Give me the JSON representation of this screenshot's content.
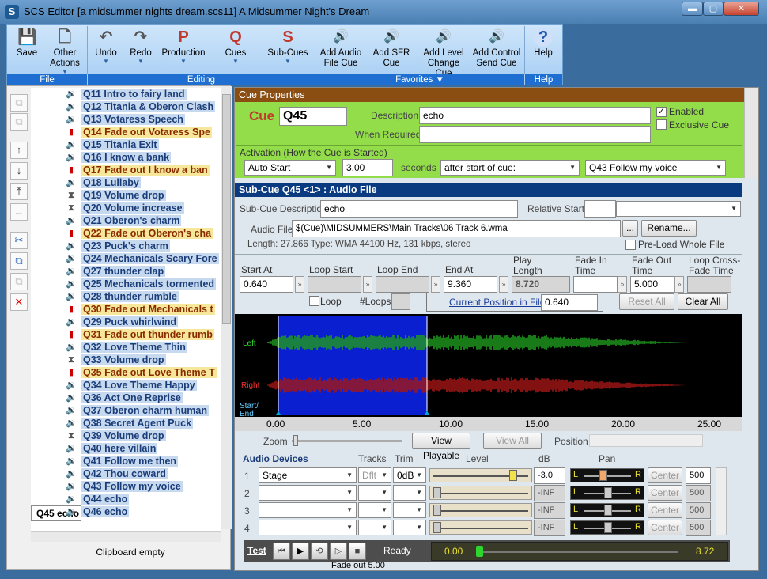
{
  "window": {
    "app_icon": "S",
    "title": "SCS Editor  [a midsummer nights dream.scs11]  A Midsummer Night's Dream",
    "min": "▬",
    "max": "▢",
    "close": "✕"
  },
  "ribbon": {
    "buttons": [
      {
        "label": "Save",
        "icon": "💾",
        "color": "#1a56b0"
      },
      {
        "label": "Other Actions",
        "icon": "🗋",
        "color": "#555555"
      },
      {
        "label": "Undo",
        "icon": "↶",
        "color": "#555555"
      },
      {
        "label": "Redo",
        "icon": "↷",
        "color": "#555555"
      },
      {
        "label": "Production",
        "icon": "P",
        "color": "#c0392b"
      },
      {
        "label": "Cues",
        "icon": "Q",
        "color": "#c0392b"
      },
      {
        "label": "Sub-Cues",
        "icon": "S",
        "color": "#c0392b"
      },
      {
        "label": "Add Audio File Cue",
        "icon": "🔊",
        "color": "#1a56b0"
      },
      {
        "label": "Add SFR Cue",
        "icon": "🔊",
        "color": "#1a56b0"
      },
      {
        "label": "Add Level Change Cue",
        "icon": "🔊",
        "color": "#1a56b0"
      },
      {
        "label": "Add Control Send Cue",
        "icon": "🔊",
        "color": "#1a56b0"
      },
      {
        "label": "Help",
        "icon": "?",
        "color": "#1a56b0"
      }
    ],
    "groups": {
      "file": "File",
      "editing": "Editing",
      "favorites": "Favorites ▼",
      "help": "Help"
    }
  },
  "cue_list": [
    {
      "label": "Q11 Intro to fairy land",
      "type": "audio"
    },
    {
      "label": "Q12 Titania & Oberon Clash",
      "type": "audio"
    },
    {
      "label": "Q13 Votaress Speech",
      "type": "audio"
    },
    {
      "label": "Q14 Fade out Votaress Spe",
      "type": "fade"
    },
    {
      "label": "Q15 Titania Exit",
      "type": "audio"
    },
    {
      "label": "Q16 I know a bank",
      "type": "audio"
    },
    {
      "label": "Q17 Fade out I know a ban",
      "type": "fade"
    },
    {
      "label": "Q18 Lullaby",
      "type": "audio"
    },
    {
      "label": "Q19 Volume drop",
      "type": "level"
    },
    {
      "label": "Q20 Volume increase",
      "type": "level"
    },
    {
      "label": "Q21 Oberon's charm",
      "type": "audio"
    },
    {
      "label": "Q22 Fade out Oberon's cha",
      "type": "fade"
    },
    {
      "label": "Q23 Puck's charm",
      "type": "audio"
    },
    {
      "label": "Q24 Mechanicals Scary Fore",
      "type": "audio"
    },
    {
      "label": "Q27 thunder clap",
      "type": "audio"
    },
    {
      "label": "Q25 Mechanicals tormented",
      "type": "audio"
    },
    {
      "label": "Q28 thunder rumble",
      "type": "audio"
    },
    {
      "label": "Q30 Fade out Mechanicals t",
      "type": "fade"
    },
    {
      "label": "Q29 Puck whirlwind",
      "type": "audio"
    },
    {
      "label": "Q31 Fade out thunder rumb",
      "type": "fade"
    },
    {
      "label": "Q32 Love Theme Thin",
      "type": "audio"
    },
    {
      "label": "Q33 Volume drop",
      "type": "level"
    },
    {
      "label": "Q35 Fade out Love Theme T",
      "type": "fade"
    },
    {
      "label": "Q34 Love Theme Happy",
      "type": "audio"
    },
    {
      "label": "Q36 Act One Reprise",
      "type": "audio"
    },
    {
      "label": "Q37 Oberon charm human",
      "type": "audio"
    },
    {
      "label": "Q38 Secret Agent Puck",
      "type": "audio"
    },
    {
      "label": "Q39 Volume drop",
      "type": "level"
    },
    {
      "label": "Q40 here villain",
      "type": "audio"
    },
    {
      "label": "Q41 Follow me then",
      "type": "audio"
    },
    {
      "label": "Q42 Thou coward",
      "type": "audio"
    },
    {
      "label": "Q43 Follow my voice",
      "type": "audio"
    },
    {
      "label": "Q44 echo",
      "type": "audio"
    },
    {
      "label": "Q45 echo",
      "type": "selected"
    },
    {
      "label": "Q46 echo",
      "type": "audio"
    }
  ],
  "left_tools": [
    "⧉",
    "⧉",
    "↑",
    "↓",
    "⤒",
    "←",
    "✂",
    "⧉",
    "⧉",
    "✕"
  ],
  "clipboard_status": "Clipboard empty",
  "cue_props": {
    "header": "Cue Properties",
    "cue_label": "Cue",
    "cue_value": "Q45",
    "description_label": "Description",
    "description_value": "echo",
    "when_required_label": "When Required",
    "when_required_value": "",
    "enabled_label": "Enabled",
    "enabled_checked": "✓",
    "exclusive_label": "Exclusive Cue",
    "activation_label": "Activation (How the Cue is Started)",
    "activation_value": "Auto Start",
    "activation_time": "3.00",
    "seconds_label": "seconds",
    "after_value": "after start of cue:",
    "follow_value": "Q43  Follow my voice"
  },
  "subcue": {
    "header": "Sub-Cue Q45 <1> : Audio File",
    "desc_label": "Sub-Cue Description",
    "desc_value": "echo",
    "relative_start_label": "Relative Start",
    "relative_start_value": "",
    "audio_file_label": "Audio File",
    "audio_file_value": "$(Cue)\\MIDSUMMERS\\Main Tracks\\06 Track 6.wma",
    "browse_label": "...",
    "rename_label": "Rename...",
    "file_info": "Length: 27.866  Type: WMA 44100 Hz, 131 kbps, stereo",
    "preload_label": "Pre-Load Whole File",
    "start_at_label": "Start At",
    "start_at_value": "0.640",
    "loop_start_label": "Loop Start",
    "loop_end_label": "Loop End",
    "end_at_label": "End At",
    "end_at_value": "9.360",
    "play_length_label": "Play Length",
    "play_length_value": "8.720",
    "fade_in_label": "Fade In Time",
    "fade_in_value": "",
    "fade_out_label": "Fade Out Time",
    "fade_out_value": "5.000",
    "loop_crossfade_label": "Loop Cross-Fade Time",
    "loop_label": "Loop",
    "nloops_label": "#Loops",
    "current_pos_label": "Current Position in File:",
    "current_pos_value": "0.640",
    "reset_all_label": "Reset All",
    "clear_all_label": "Clear All",
    "expand": "»"
  },
  "waveform": {
    "left_label": "Left",
    "right_label": "Right",
    "startend_label": "Start/ End",
    "left_color": "#1e9a1e",
    "right_color": "#a31616",
    "selection_color": "#0a1fd0",
    "ticks": [
      "0.00",
      "5.00",
      "10.00",
      "15.00",
      "20.00",
      "25.00"
    ]
  },
  "zoom": {
    "zoom_label": "Zoom",
    "view_playable_label": "View Playable",
    "view_all_label": "View All",
    "position_label": "Position"
  },
  "devices": {
    "header_label": "Audio Devices",
    "tracks_label": "Tracks",
    "trim_label": "Trim",
    "level_label": "Level",
    "db_label": "dB",
    "pan_label": "Pan",
    "rows": [
      {
        "num": "1",
        "device": "Stage",
        "tracks": "Dflt",
        "trim": "0dB",
        "db": "-3.0",
        "center": "Center",
        "pan": "500",
        "level": 0.86,
        "panpos": 0.38
      },
      {
        "num": "2",
        "device": "",
        "tracks": "",
        "trim": "",
        "db": "-INF",
        "center": "Center",
        "pan": "500",
        "level": 0.0,
        "panpos": 0.5
      },
      {
        "num": "3",
        "device": "",
        "tracks": "",
        "trim": "",
        "db": "-INF",
        "center": "Center",
        "pan": "500",
        "level": 0.0,
        "panpos": 0.5
      },
      {
        "num": "4",
        "device": "",
        "tracks": "",
        "trim": "",
        "db": "-INF",
        "center": "Center",
        "pan": "500",
        "level": 0.0,
        "panpos": 0.5
      }
    ]
  },
  "test": {
    "test_label": "Test",
    "status": "Ready",
    "pos_start": "0.00",
    "pos_end": "8.72",
    "fade_info": "Fade out 5.00",
    "buttons": [
      "⏮",
      "▶",
      "⟲",
      "▷",
      "■"
    ]
  }
}
